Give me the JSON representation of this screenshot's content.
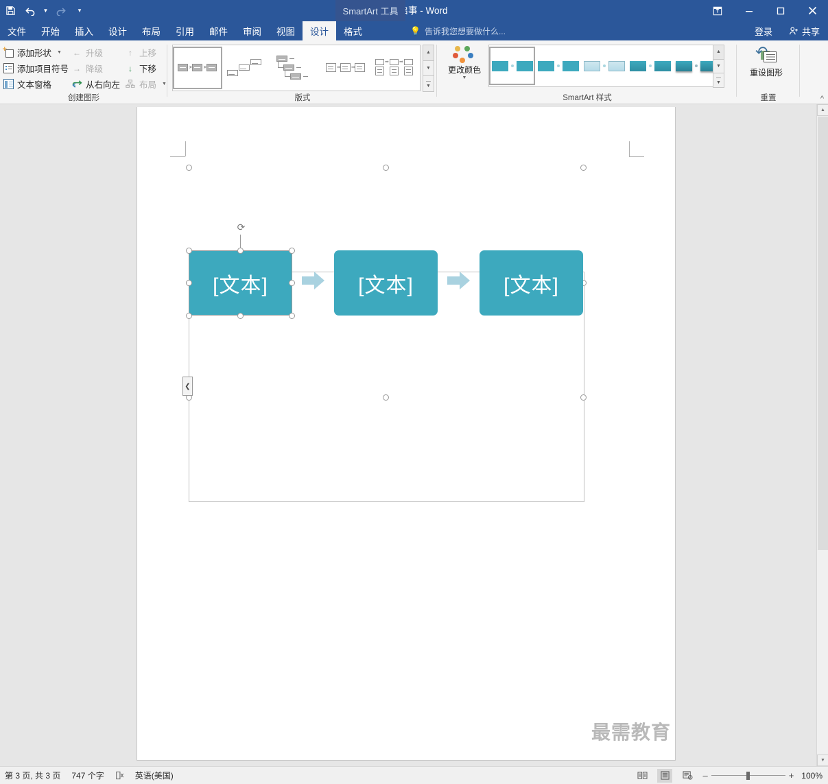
{
  "titlebar": {
    "document_title": "招聘启事 - Word",
    "contextual_tab_group": "SmartArt 工具",
    "qat": [
      {
        "name": "save-icon",
        "glyph": "ὋE"
      },
      {
        "name": "undo-icon",
        "glyph": "↶"
      },
      {
        "name": "redo-icon",
        "glyph": "↷"
      }
    ],
    "window_controls": {
      "ribbon_display": "⤒",
      "minimize": "–",
      "maximize": "☐",
      "close": "✕"
    }
  },
  "tabs": [
    {
      "label": "文件",
      "active": false
    },
    {
      "label": "开始",
      "active": false
    },
    {
      "label": "插入",
      "active": false
    },
    {
      "label": "设计",
      "active": false
    },
    {
      "label": "布局",
      "active": false
    },
    {
      "label": "引用",
      "active": false
    },
    {
      "label": "邮件",
      "active": false
    },
    {
      "label": "审阅",
      "active": false
    },
    {
      "label": "视图",
      "active": false
    },
    {
      "label": "设计",
      "active": true
    },
    {
      "label": "格式",
      "active": false
    }
  ],
  "tellme": {
    "placeholder": "告诉我您想要做什么...",
    "icon": "lightbulb-icon"
  },
  "account": {
    "signin_label": "登录",
    "share_label": "共享"
  },
  "ribbon": {
    "groups": [
      {
        "name": "create-graphic",
        "label": "创建图形",
        "items": [
          {
            "label": "添加形状",
            "icon": "add-shape-icon",
            "disabled": false,
            "has_caret": true
          },
          {
            "label": "添加项目符号",
            "icon": "add-bullet-icon",
            "disabled": false,
            "has_caret": false
          },
          {
            "label": "文本窗格",
            "icon": "text-pane-icon",
            "disabled": false,
            "has_caret": false
          },
          {
            "label": "升级",
            "icon": "promote-icon",
            "disabled": true,
            "has_caret": false
          },
          {
            "label": "降级",
            "icon": "demote-icon",
            "disabled": true,
            "has_caret": false
          },
          {
            "label": "从右向左",
            "icon": "right-to-left-icon",
            "disabled": false,
            "has_caret": false
          },
          {
            "label": "上移",
            "icon": "move-up-icon",
            "disabled": true,
            "has_caret": false
          },
          {
            "label": "下移",
            "icon": "move-down-icon",
            "disabled": false,
            "has_caret": false
          },
          {
            "label": "布局",
            "icon": "layout-icon",
            "disabled": true,
            "has_caret": true
          }
        ]
      },
      {
        "name": "layouts",
        "label": "版式",
        "gallery_selected_index": 0,
        "scroll_buttons": [
          "up",
          "down",
          "more"
        ]
      },
      {
        "name": "smartart-styles",
        "label": "SmartArt 样式",
        "change_colors_label": "更改颜色",
        "gallery_selected_index": 0,
        "scroll_buttons": [
          "up",
          "down",
          "more"
        ]
      },
      {
        "name": "reset",
        "label": "重置",
        "reset_graphic_label": "重设图形",
        "collapse_ribbon_icon": "chevron-up-icon"
      }
    ]
  },
  "document": {
    "smartart": {
      "type": "basic-process",
      "nodes": [
        {
          "text": "[文本]",
          "selected": true
        },
        {
          "text": "[文本]",
          "selected": false
        },
        {
          "text": "[文本]",
          "selected": false
        }
      ],
      "connector": "arrow-right",
      "node_color": "#3da9be",
      "arrow_color": "#a9d2e0",
      "text_pane_toggle_icon": "chevron-left-icon"
    },
    "watermark": "最需教育"
  },
  "statusbar": {
    "page_info": "第 3 页, 共 3 页",
    "word_count": "747 个字",
    "proofing_icon": "spelling-check-icon",
    "language": "英语(美国)",
    "views": [
      {
        "name": "read-mode-icon",
        "active": false
      },
      {
        "name": "print-layout-icon",
        "active": true
      },
      {
        "name": "web-layout-icon",
        "active": false
      }
    ],
    "zoom_out": "–",
    "zoom_in": "+",
    "zoom_level": "100%"
  }
}
